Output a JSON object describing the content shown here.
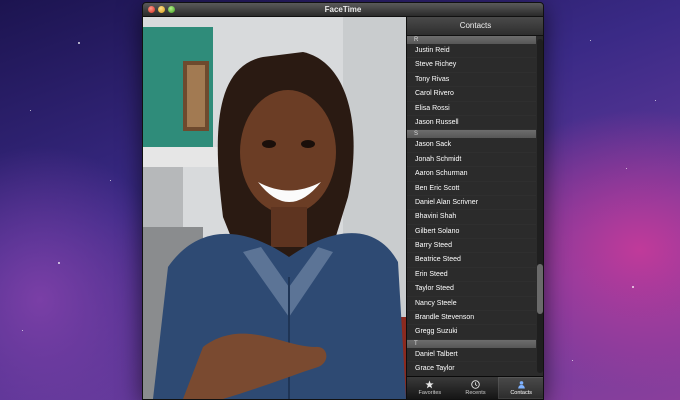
{
  "window": {
    "title": "FaceTime"
  },
  "contacts": {
    "header": "Contacts",
    "sections": [
      {
        "letter": "R",
        "names": [
          "Justin Reid",
          "Steve Richey",
          "Tony Rivas",
          "Carol Rivero",
          "Elisa Rossi",
          "Jason Russell"
        ]
      },
      {
        "letter": "S",
        "names": [
          "Jason Sack",
          "Jonah Schmidt",
          "Aaron Schurman",
          "Ben Eric Scott",
          "Daniel Alan Scrivner",
          "Bhavini Shah",
          "Gilbert Solano",
          "Barry Steed",
          "Beatrice Steed",
          "Erin Steed",
          "Taylor Steed",
          "Nancy Steele",
          "Brandle Stevenson",
          "Gregg Suzuki"
        ]
      },
      {
        "letter": "T",
        "names": [
          "Daniel Talbert",
          "Grace Taylor"
        ]
      }
    ]
  },
  "tabs": [
    {
      "label": "Favorites",
      "icon": "star-icon"
    },
    {
      "label": "Recents",
      "icon": "clock-icon"
    },
    {
      "label": "Contacts",
      "icon": "person-icon",
      "active": true
    }
  ]
}
